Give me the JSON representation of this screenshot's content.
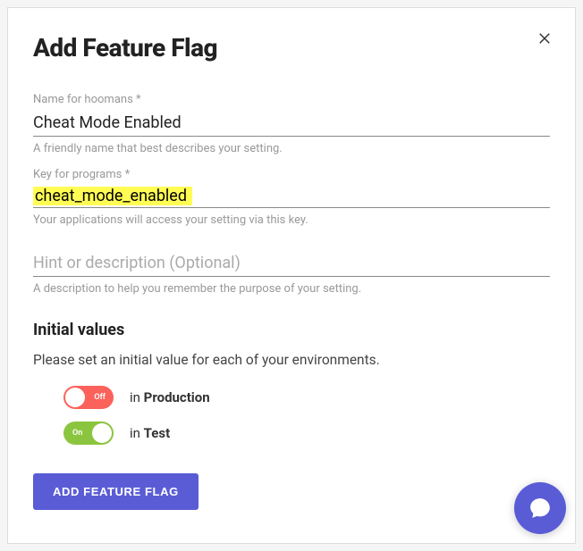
{
  "modal": {
    "title": "Add Feature Flag",
    "fields": {
      "name": {
        "label": "Name for hoomans *",
        "value": "Cheat Mode Enabled",
        "helper": "A friendly name that best describes your setting."
      },
      "key": {
        "label": "Key for programs *",
        "value": "cheat_mode_enabled",
        "helper": "Your applications will access your setting via this key."
      },
      "hint": {
        "placeholder": "Hint or description (Optional)",
        "value": "",
        "helper": "A description to help you remember the purpose of your setting."
      }
    },
    "initial": {
      "heading": "Initial values",
      "instruction": "Please set an initial value for each of your environments.",
      "envs": [
        {
          "toggle_label": "Off",
          "state": "off",
          "in": "in",
          "name": "Production"
        },
        {
          "toggle_label": "On",
          "state": "on",
          "in": "in",
          "name": "Test"
        }
      ]
    },
    "submit": "ADD FEATURE FLAG"
  }
}
